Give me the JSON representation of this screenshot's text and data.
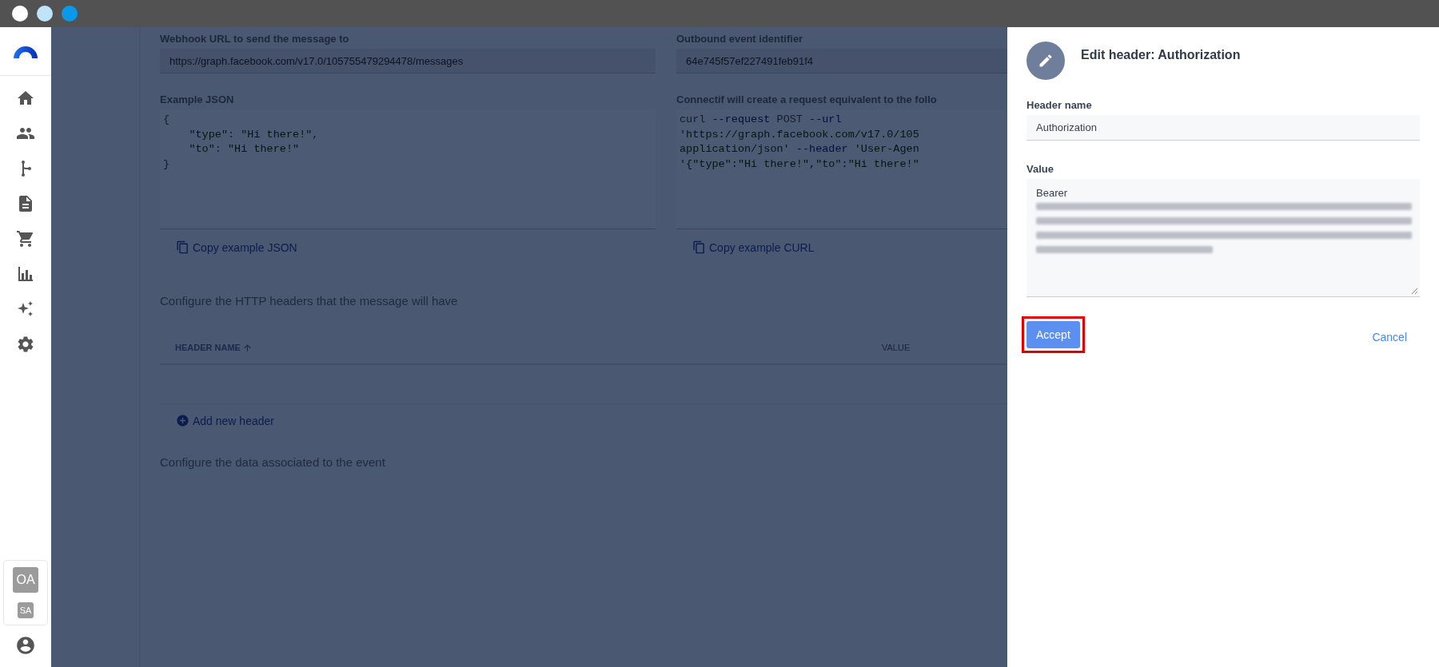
{
  "sidebar": {
    "accounts": [
      {
        "initials": "OA",
        "selected": true
      },
      {
        "initials": "SA",
        "selected": false
      }
    ]
  },
  "form": {
    "webhook_url": {
      "label": "Webhook URL to send the message to",
      "value": "https://graph.facebook.com/v17.0/105755479294478/messages"
    },
    "event_id": {
      "label": "Outbound event identifier",
      "value": "64e745f57ef227491feb91f4"
    },
    "example_json": {
      "label": "Example JSON",
      "lines": [
        [
          {
            "text": "{",
            "kind": "plain"
          }
        ],
        [
          {
            "text": "    \"type\"",
            "kind": "string"
          },
          {
            "text": ": ",
            "kind": "plain"
          },
          {
            "text": "\"Hi there!\"",
            "kind": "string"
          },
          {
            "text": ",",
            "kind": "plain"
          }
        ],
        [
          {
            "text": "    \"to\"",
            "kind": "string"
          },
          {
            "text": ": ",
            "kind": "plain"
          },
          {
            "text": "\"Hi there!\"",
            "kind": "string"
          }
        ],
        [
          {
            "text": "}",
            "kind": "plain"
          }
        ]
      ],
      "copy_label": "Copy example JSON"
    },
    "example_curl": {
      "label": "Connectif will create a request equivalent to the follo",
      "lines": [
        [
          {
            "text": "curl ",
            "kind": "plain"
          },
          {
            "text": "--request",
            "kind": "flag"
          },
          {
            "text": " POST ",
            "kind": "plain"
          },
          {
            "text": "--url",
            "kind": "flag"
          }
        ],
        [
          {
            "text": "'https://graph.facebook.com/v17.0/105",
            "kind": "string"
          }
        ],
        [
          {
            "text": "application/json' ",
            "kind": "string"
          },
          {
            "text": "--header",
            "kind": "flag"
          },
          {
            "text": " 'User-Agen",
            "kind": "string"
          }
        ],
        [
          {
            "text": "'{\"type\":\"Hi there!\",\"to\":\"Hi there!\"",
            "kind": "string"
          }
        ]
      ],
      "copy_label": "Copy example CURL"
    },
    "headers_intro": "Configure the HTTP headers that the message will have",
    "headers_table": {
      "columns": [
        {
          "label": "HEADER NAME",
          "sorted": true
        },
        {
          "label": "VALUE",
          "sorted": false
        }
      ]
    },
    "add_header": "Add new header",
    "data_intro": "Configure the data associated to the event"
  },
  "panel": {
    "title": "Edit header: Authorization",
    "header_name": {
      "label": "Header name",
      "value": "Authorization"
    },
    "value": {
      "label": "Value",
      "value": "Bearer"
    },
    "accept": {
      "label": "Accept",
      "highlighted": true
    },
    "cancel": "Cancel"
  }
}
